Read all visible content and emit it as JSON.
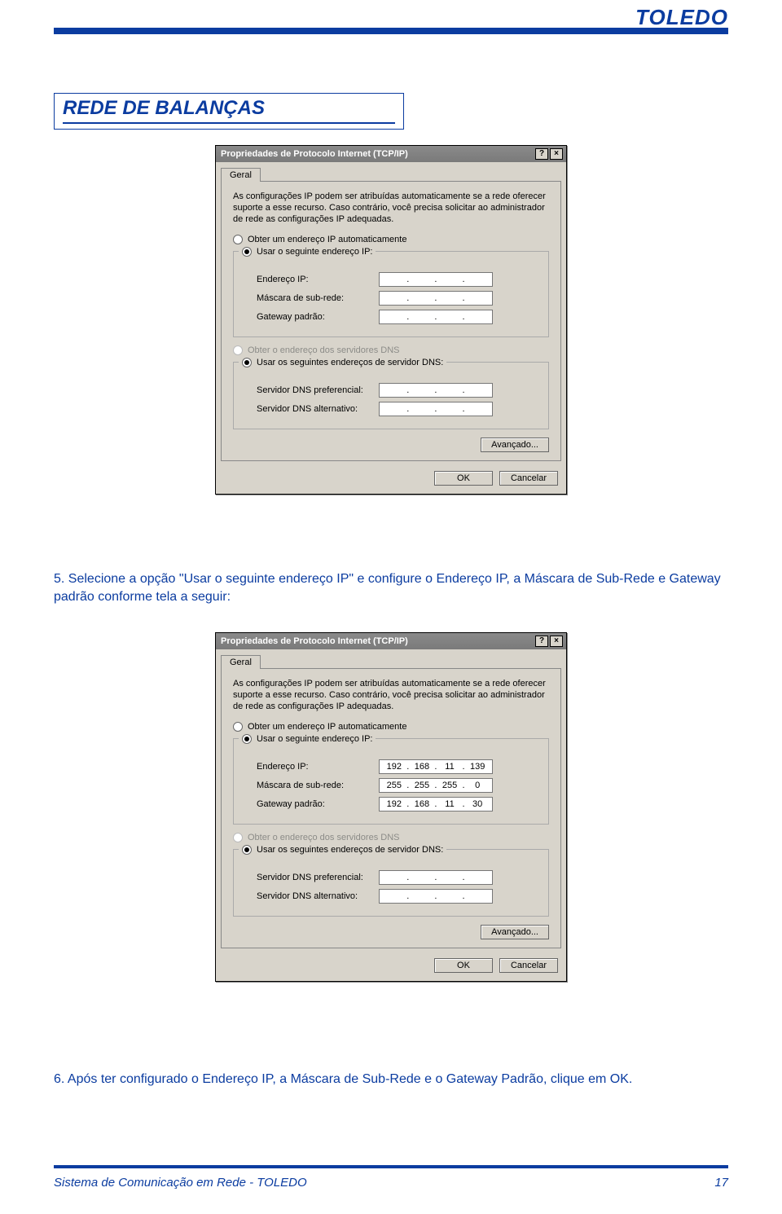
{
  "brand": "TOLEDO",
  "section_title": "REDE DE BALANÇAS",
  "step5_text": "5. Selecione a opção \"Usar o seguinte endereço IP\" e configure o Endereço IP, a Máscara de Sub-Rede e Gateway padrão conforme tela a seguir:",
  "step6_text": "6. Após ter configurado o Endereço IP, a Máscara de Sub-Rede e o Gateway Padrão,  clique em OK.",
  "footer_left": "Sistema de Comunicação em Rede - TOLEDO",
  "footer_page": "17",
  "dialog": {
    "title": "Propriedades de Protocolo Internet (TCP/IP)",
    "help_btn": "?",
    "close_btn": "×",
    "tab": "Geral",
    "help": "As configurações IP podem ser atribuídas automaticamente se a rede oferecer suporte a esse recurso. Caso contrário, você precisa solicitar ao administrador de rede as configurações IP adequadas.",
    "radio_auto_ip": "Obter um endereço IP automaticamente",
    "radio_manual_ip": "Usar o seguinte endereço IP:",
    "lbl_ip": "Endereço IP:",
    "lbl_mask": "Máscara de sub-rede:",
    "lbl_gw": "Gateway padrão:",
    "radio_auto_dns": "Obter o endereço dos servidores DNS",
    "radio_manual_dns": "Usar os seguintes endereços de servidor DNS:",
    "lbl_dns1": "Servidor DNS preferencial:",
    "lbl_dns2": "Servidor DNS alternativo:",
    "btn_adv": "Avançado...",
    "btn_ok": "OK",
    "btn_cancel": "Cancelar"
  },
  "dialog2_values": {
    "ip": [
      "192",
      "168",
      "11",
      "139"
    ],
    "mask": [
      "255",
      "255",
      "255",
      "0"
    ],
    "gw": [
      "192",
      "168",
      "11",
      "30"
    ]
  }
}
